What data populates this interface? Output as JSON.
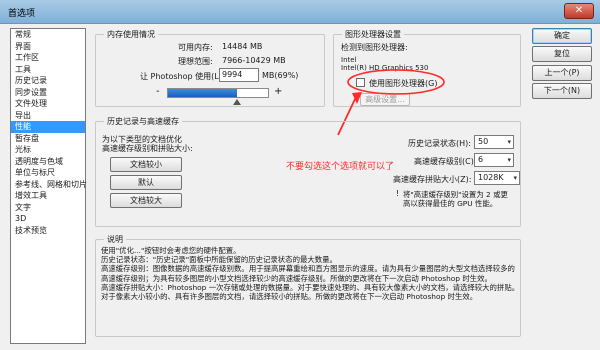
{
  "window": {
    "title": "首选项",
    "close_glyph": "✕"
  },
  "sidebar": {
    "items": [
      {
        "label": "常规"
      },
      {
        "label": "界面"
      },
      {
        "label": "工作区"
      },
      {
        "label": "工具"
      },
      {
        "label": "历史记录"
      },
      {
        "label": "同步设置"
      },
      {
        "label": "文件处理"
      },
      {
        "label": "导出"
      },
      {
        "label": "性能"
      },
      {
        "label": "暂存盘"
      },
      {
        "label": "光标"
      },
      {
        "label": "透明度与色域"
      },
      {
        "label": "单位与标尺"
      },
      {
        "label": "参考线、网格和切片"
      },
      {
        "label": "增效工具"
      },
      {
        "label": "文字"
      },
      {
        "label": "3D"
      },
      {
        "label": "技术预览"
      }
    ],
    "selected_index": 8
  },
  "memory": {
    "title": "内存使用情况",
    "available_label": "可用内存:",
    "available_value": "14484 MB",
    "ideal_label": "理想范围:",
    "ideal_value": "7966-10429 MB",
    "usage_label": "让 Photoshop 使用(L):",
    "usage_value": "9994",
    "usage_unit": "MB(69%)",
    "slider_fraction": 0.69,
    "minus": "-",
    "plus": "+"
  },
  "gpu": {
    "title": "图形处理器设置",
    "detected_label": "检测到图形处理器:",
    "vendor": "Intel",
    "model": "Intel(R) HD Graphics 530",
    "use_gpu_label": "使用图形处理器(G)",
    "use_gpu_checked": false,
    "advanced_button": "高级设置..."
  },
  "history": {
    "title": "历史记录与高速缓存",
    "optimize_line1": "为以下类型的文档优化",
    "optimize_line2": "高速缓存级别和拼贴大小:",
    "btn_small": "文档较小",
    "btn_default": "默认",
    "btn_large": "文档较大",
    "states_label": "历史记录状态(H):",
    "states_value": "50",
    "levels_label": "高速缓存级别(C):",
    "levels_value": "6",
    "tile_label": "高速缓存拼贴大小(Z):",
    "tile_value": "1028K",
    "note_line1": "将\"高速缓存级别\"设置为 2 或更",
    "note_line2": "高以获得最佳的 GPU 性能。"
  },
  "annotation": {
    "text": "不要勾选这个选项就可以了",
    "color": "#ff2a2a"
  },
  "description": {
    "title": "说明",
    "lines": [
      "使用\"优化...\"按钮时会考虑您的硬件配置。",
      "历史记录状态：\"历史记录\"面板中所能保留的历史记录状态的最大数量。",
      "高速缓存级别：图像数据的高速缓存级别数。用于提高屏幕重绘和直方图显示的速度。请为具有少量图层的大型文档选择较多的",
      "高速缓存级别；为具有较多图层的小型文档选择较少的高速缓存级别。所做的更改将在下一次启动 Photoshop 时生效。",
      "高速缓存拼贴大小：Photoshop 一次存储或处理的数据量。对于要快速处理的、具有较大像素大小的文档，请选择较大的拼贴。",
      "对于像素大小较小的、具有许多图层的文档，请选择较小的拼贴。所做的更改将在下一次启动 Photoshop 时生效。"
    ]
  },
  "buttons": {
    "ok": "确定",
    "reset": "复位",
    "prev": "上一个(P)",
    "next": "下一个(N)"
  }
}
